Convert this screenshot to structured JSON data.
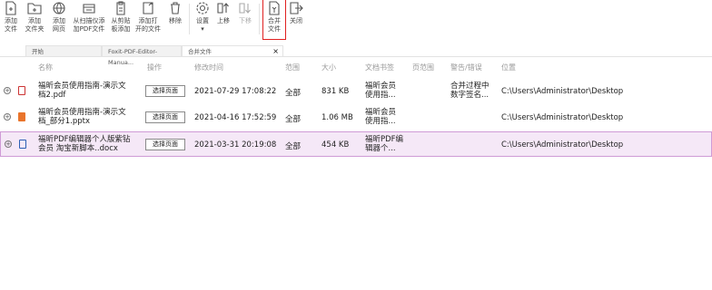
{
  "toolbar": {
    "buttons": [
      {
        "label": "添加\n文件",
        "icon": "add-file-icon"
      },
      {
        "label": "添加\n文件夹",
        "icon": "add-folder-icon"
      },
      {
        "label": "添加\n网页",
        "icon": "add-web-icon"
      },
      {
        "label": "从扫描仪添\n加PDF文件",
        "icon": "scanner-icon"
      },
      {
        "label": "从剪贴\n板添加",
        "icon": "clipboard-icon"
      },
      {
        "label": "添加打\n开的文件",
        "icon": "open-files-icon"
      },
      {
        "label": "移除",
        "icon": "trash-icon"
      },
      {
        "label": "设置\n▾",
        "icon": "gear-icon"
      },
      {
        "label": "上移",
        "icon": "move-up-icon"
      },
      {
        "label": "下移",
        "icon": "move-down-icon"
      },
      {
        "label": "合并\n文件",
        "icon": "merge-icon"
      },
      {
        "label": "关闭",
        "icon": "close-icon"
      }
    ],
    "highlight_color": "#e02020"
  },
  "tabs": [
    {
      "label": "开始"
    },
    {
      "label": "Foxit-PDF-Editor-Manua..."
    },
    {
      "label": "合并文件",
      "close": "×"
    }
  ],
  "table": {
    "headers": [
      "名称",
      "操作",
      "修改时间",
      "范围",
      "大小",
      "文档书签",
      "页范围",
      "警告/错误",
      "位置"
    ],
    "select_button_label": "选择页面",
    "rows": [
      {
        "name": "福昕会员使用指南-演示文\n档2.pdf",
        "type": "pdf",
        "modified": "2021-07-29 17:08:22",
        "range": "全部",
        "size": "831 KB",
        "bookmark": "福昕会员\n使用指...",
        "pagerange": "",
        "warning": "合并过程中\n数字签名...",
        "location": "C:\\Users\\Administrator\\Desktop"
      },
      {
        "name": "福昕会员使用指南-演示文\n档_部分1.pptx",
        "type": "pptx",
        "modified": "2021-04-16 17:52:59",
        "range": "全部",
        "size": "1.06 MB",
        "bookmark": "福昕会员\n使用指...",
        "pagerange": "",
        "warning": "",
        "location": "C:\\Users\\Administrator\\Desktop"
      },
      {
        "name": "福昕PDF编辑器个人版紫钻\n会员 淘宝新脚本..docx",
        "type": "docx",
        "modified": "2021-03-31 20:19:08",
        "range": "全部",
        "size": "454 KB",
        "bookmark": "福昕PDF编\n辑器个...",
        "pagerange": "",
        "warning": "",
        "location": "C:\\Users\\Administrator\\Desktop"
      }
    ]
  }
}
